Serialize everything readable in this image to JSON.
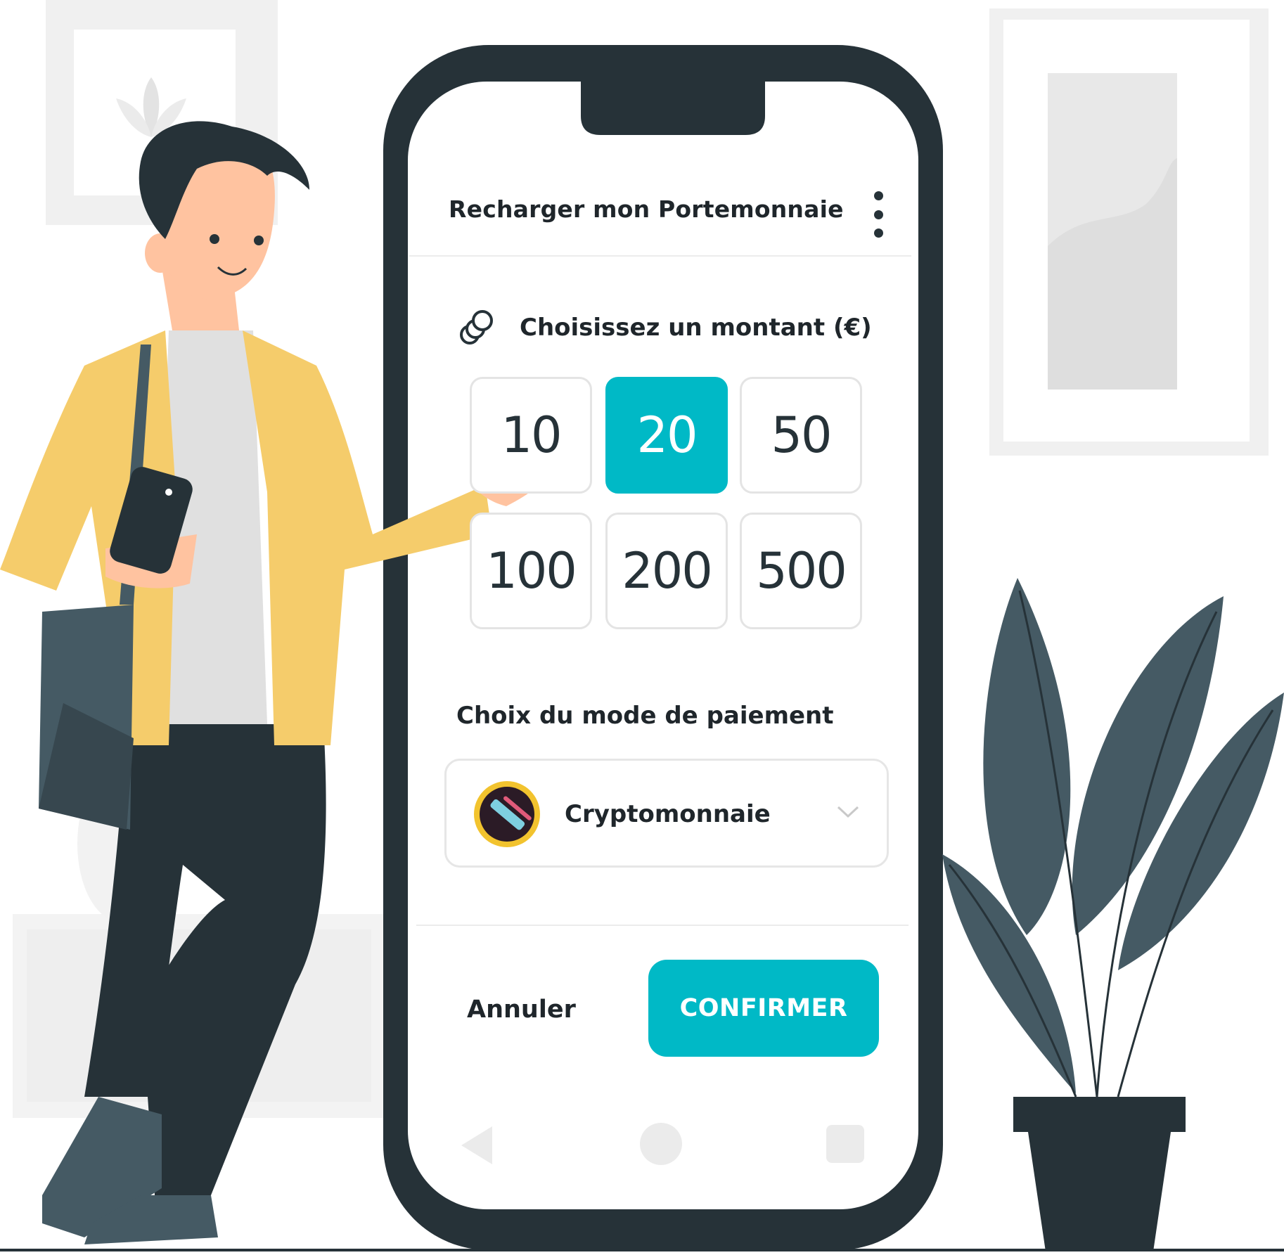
{
  "screen": {
    "title": "Recharger mon Portemonnaie",
    "amount_label": "Choisissez un montant (€)",
    "amounts": [
      "10",
      "20",
      "50",
      "100",
      "200",
      "500"
    ],
    "selected_amount": "20",
    "payment_label": "Choix du mode de paiement",
    "payment_method": "Cryptomonnaie",
    "cancel_label": "Annuler",
    "confirm_label": "CONFIRMER"
  },
  "colors": {
    "accent": "#00b9c6",
    "phone_frame": "#263238",
    "jacket": "#f5cc6b",
    "plant": "#455a64"
  },
  "icons": [
    "menu-dots-icon",
    "coins-icon",
    "crypto-logo-icon",
    "chevron-down-icon",
    "nav-back-icon",
    "nav-home-icon",
    "nav-recent-icon"
  ]
}
